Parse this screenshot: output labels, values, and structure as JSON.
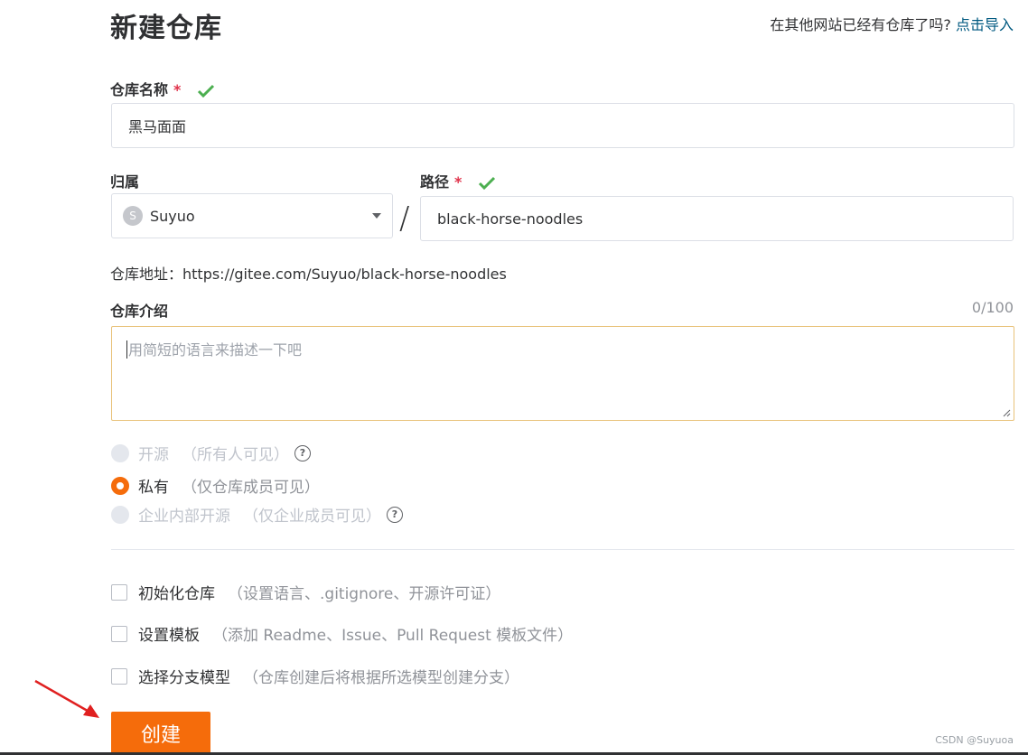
{
  "header": {
    "title": "新建仓库",
    "import_hint": "在其他网站已经有仓库了吗?",
    "import_link": "点击导入"
  },
  "repo_name": {
    "label": "仓库名称",
    "required_mark": "*",
    "value": "黑马面面"
  },
  "owner": {
    "label": "归属",
    "avatar_letter": "S",
    "value": "Suyuo"
  },
  "separator": "/",
  "path": {
    "label": "路径",
    "required_mark": "*",
    "value": "black-horse-noodles"
  },
  "repo_url": "仓库地址：https://gitee.com/Suyuo/black-horse-noodles",
  "description": {
    "label": "仓库介绍",
    "counter": "0/100",
    "placeholder": "用简短的语言来描述一下吧"
  },
  "visibility": [
    {
      "label": "开源",
      "note": "（所有人可见）",
      "state": "disabled",
      "help": "?"
    },
    {
      "label": "私有",
      "note": "（仅仓库成员可见）",
      "state": "checked",
      "help": ""
    },
    {
      "label": "企业内部开源",
      "note": "（仅企业成员可见）",
      "state": "disabled",
      "help": "?"
    }
  ],
  "options": [
    {
      "label": "初始化仓库",
      "note": "（设置语言、.gitignore、开源许可证）",
      "checked": false
    },
    {
      "label": "设置模板",
      "note": "（添加 Readme、Issue、Pull Request 模板文件）",
      "checked": false
    },
    {
      "label": "选择分支模型",
      "note": "（仓库创建后将根据所选模型创建分支）",
      "checked": false
    }
  ],
  "submit_label": "创建",
  "watermark": "CSDN @Suyuoa",
  "colors": {
    "accent": "#f56c0b",
    "check": "#4caf50",
    "link": "#005980",
    "arrow": "#e02020"
  }
}
